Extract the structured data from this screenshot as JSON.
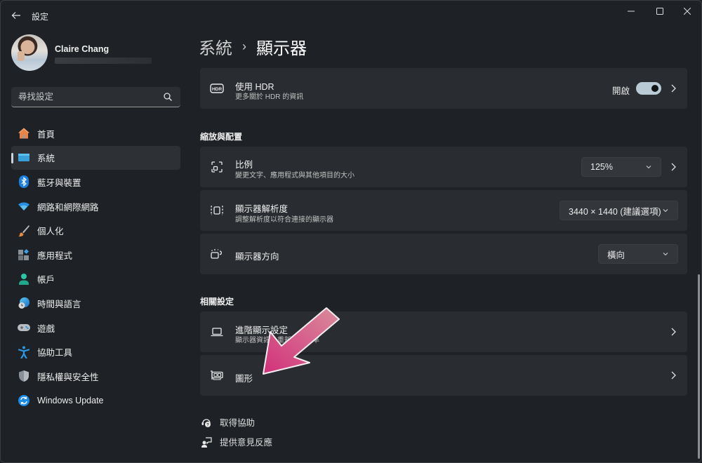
{
  "window": {
    "title": "設定",
    "controls": {
      "minimize": "minimize-icon",
      "maximize": "maximize-icon",
      "close": "close-icon"
    }
  },
  "profile": {
    "name": "Claire Chang"
  },
  "search": {
    "placeholder": "尋找設定",
    "value": ""
  },
  "sidebar": {
    "items": [
      {
        "label": "首頁",
        "icon": "home-icon",
        "active": false
      },
      {
        "label": "系統",
        "icon": "system-display-icon",
        "active": true
      },
      {
        "label": "藍牙與裝置",
        "icon": "bluetooth-icon",
        "active": false
      },
      {
        "label": "網路和網際網路",
        "icon": "wifi-icon",
        "active": false
      },
      {
        "label": "個人化",
        "icon": "paintbrush-icon",
        "active": false
      },
      {
        "label": "應用程式",
        "icon": "apps-icon",
        "active": false
      },
      {
        "label": "帳戶",
        "icon": "account-icon",
        "active": false
      },
      {
        "label": "時間與語言",
        "icon": "time-language-icon",
        "active": false
      },
      {
        "label": "遊戲",
        "icon": "gamepad-icon",
        "active": false
      },
      {
        "label": "協助工具",
        "icon": "accessibility-icon",
        "active": false
      },
      {
        "label": "隱私權與安全性",
        "icon": "shield-icon",
        "active": false
      },
      {
        "label": "Windows Update",
        "icon": "windows-update-icon",
        "active": false
      }
    ]
  },
  "main": {
    "breadcrumb": {
      "parent": "系統",
      "separator": "›",
      "current": "顯示器"
    },
    "hdr": {
      "title": "使用 HDR",
      "subtitle": "更多關於 HDR 的資訊",
      "toggle_label": "開啟",
      "toggle_on": true
    },
    "scale_layout": {
      "heading": "縮放與配置",
      "scale": {
        "title": "比例",
        "subtitle": "變更文字、應用程式與其他項目的大小",
        "value": "125%"
      },
      "resolution": {
        "title": "顯示器解析度",
        "subtitle": "調整解析度以符合連接的顯示器",
        "value": "3440 × 1440 (建議選項)"
      },
      "orientation": {
        "title": "顯示器方向",
        "value": "橫向"
      }
    },
    "related": {
      "heading": "相關設定",
      "advanced": {
        "title": "進階顯示設定",
        "subtitle": "顯示器資訊、重新整理頻率"
      },
      "graphics": {
        "title": "圖形"
      }
    },
    "footer": {
      "help": "取得協助",
      "feedback": "提供意見反應"
    },
    "annotation": {
      "type": "arrow",
      "color": "#d0357a",
      "points_to": "圖形"
    }
  }
}
